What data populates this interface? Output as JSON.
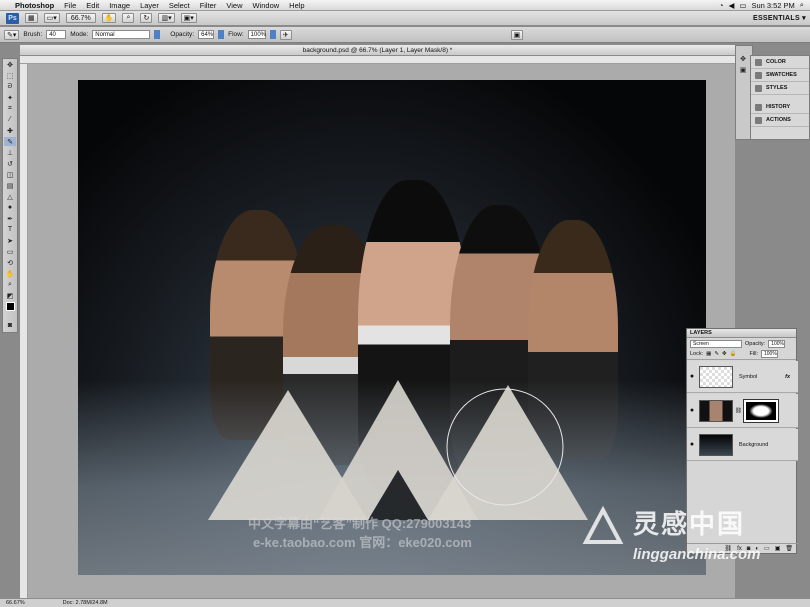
{
  "menubar": {
    "apple": "",
    "app": "Photoshop",
    "items": [
      "File",
      "Edit",
      "Image",
      "Layer",
      "Select",
      "Filter",
      "View",
      "Window",
      "Help"
    ],
    "clock": "Sun 3:52 PM"
  },
  "appbar": {
    "zoom": "66.7%",
    "workspace": "ESSENTIALS ▾"
  },
  "options": {
    "brush_label": "Brush:",
    "brush_size": "40",
    "mode_label": "Mode:",
    "mode_value": "Normal",
    "opacity_label": "Opacity:",
    "opacity_value": "64%",
    "flow_label": "Flow:",
    "flow_value": "100%"
  },
  "document": {
    "title": "background.psd @ 66.7% (Layer 1, Layer Mask/8) *"
  },
  "panels": {
    "items": [
      "COLOR",
      "SWATCHES",
      "STYLES",
      "HISTORY",
      "ACTIONS"
    ]
  },
  "layers": {
    "tab": "LAYERS",
    "blend_mode": "Screen",
    "opacity_label": "Opacity:",
    "opacity_value": "100%",
    "lock_label": "Lock:",
    "fill_label": "Fill:",
    "fill_value": "100%",
    "rows": [
      {
        "name": "Symbol",
        "fx": "fx"
      },
      {
        "name": ""
      },
      {
        "name": "Background"
      }
    ]
  },
  "watermark": {
    "line1": "中文字幕由“艺客”制作   QQ:279003143",
    "line2": "e-ke.taobao.com   官网：eke020.com",
    "brand_cn": "灵感中国",
    "brand_url": "lingganchina.com"
  },
  "status": {
    "zoom": "66.67%",
    "doc": "Doc: 2.78M/24.8M"
  },
  "colors": {
    "ps_blue": "#2a5fa5",
    "canvas_dark": "#050607"
  }
}
